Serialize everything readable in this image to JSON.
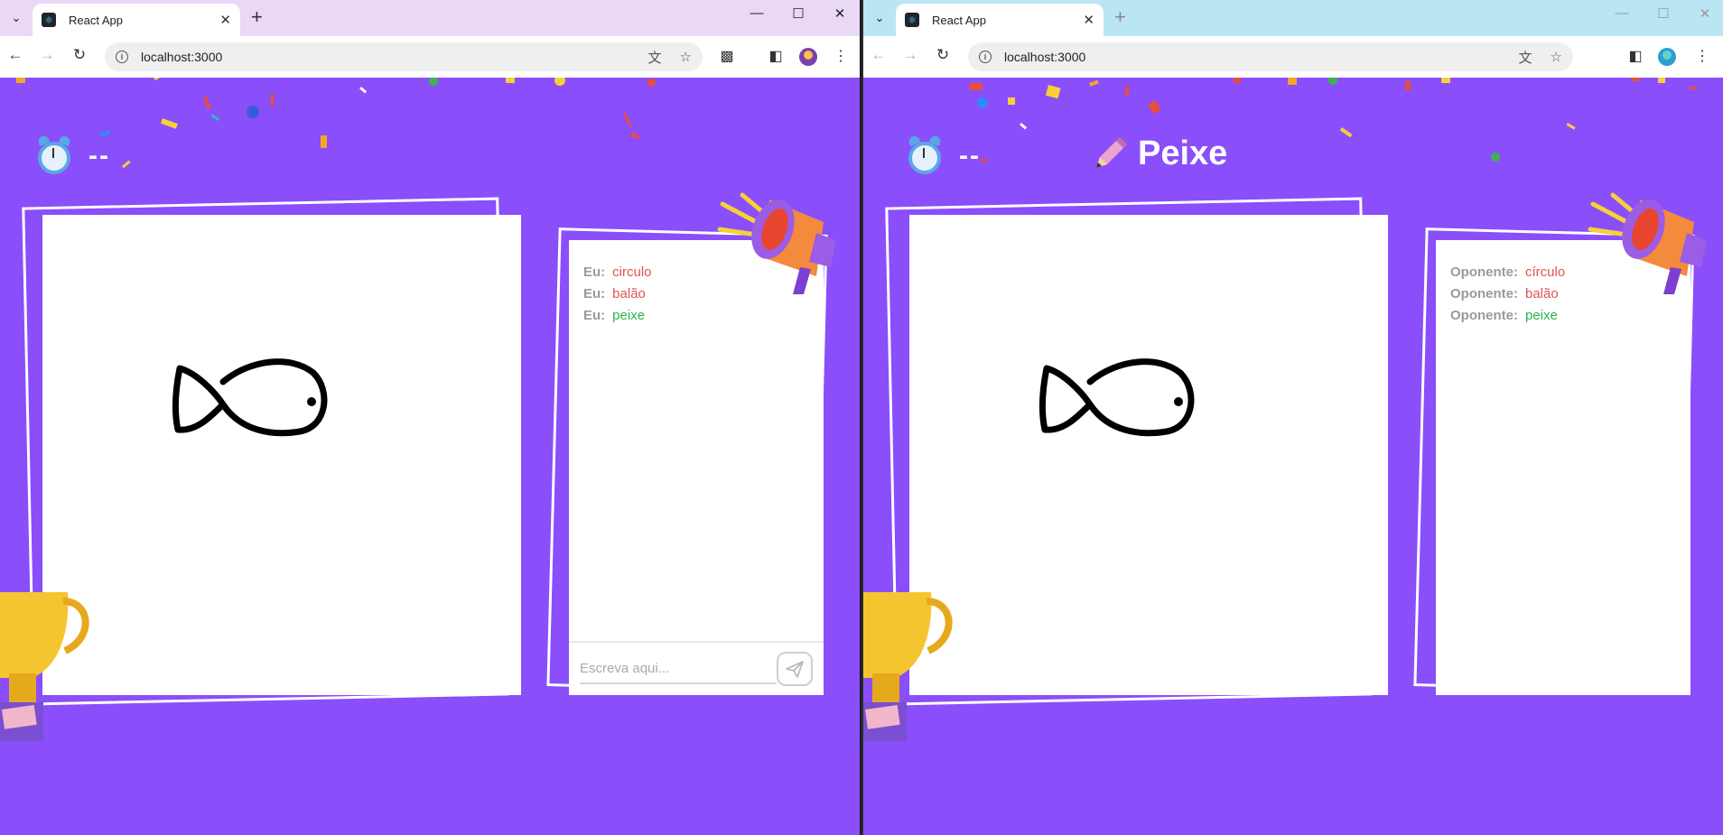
{
  "windows": [
    {
      "tab_title": "React App",
      "url": "localhost:3000",
      "timer": "--",
      "word": "",
      "messages": [
        {
          "who": "Eu:",
          "text": "circulo",
          "color": "#e05252"
        },
        {
          "who": "Eu:",
          "text": "balão",
          "color": "#e05252"
        },
        {
          "who": "Eu:",
          "text": "peixe",
          "color": "#2bb34a"
        }
      ],
      "chat_placeholder": "Escreva aqui..."
    },
    {
      "tab_title": "React App",
      "url": "localhost:3000",
      "timer": "--",
      "word": "Peixe",
      "messages": [
        {
          "who": "Oponente:",
          "text": "círculo",
          "color": "#e05252"
        },
        {
          "who": "Oponente:",
          "text": "balão",
          "color": "#e05252"
        },
        {
          "who": "Oponente:",
          "text": "peixe",
          "color": "#2bb34a"
        }
      ]
    }
  ],
  "colors": {
    "page_bg": "#8a4efb",
    "wrong_guess": "#e05252",
    "correct_guess": "#2bb34a"
  },
  "icons": [
    "react-favicon",
    "alarm-clock-icon",
    "pencil-icon",
    "megaphone-icon",
    "trophy-icon",
    "send-icon",
    "translate-icon",
    "star-icon",
    "extensions-icon",
    "side-panel-icon",
    "more-icon"
  ]
}
